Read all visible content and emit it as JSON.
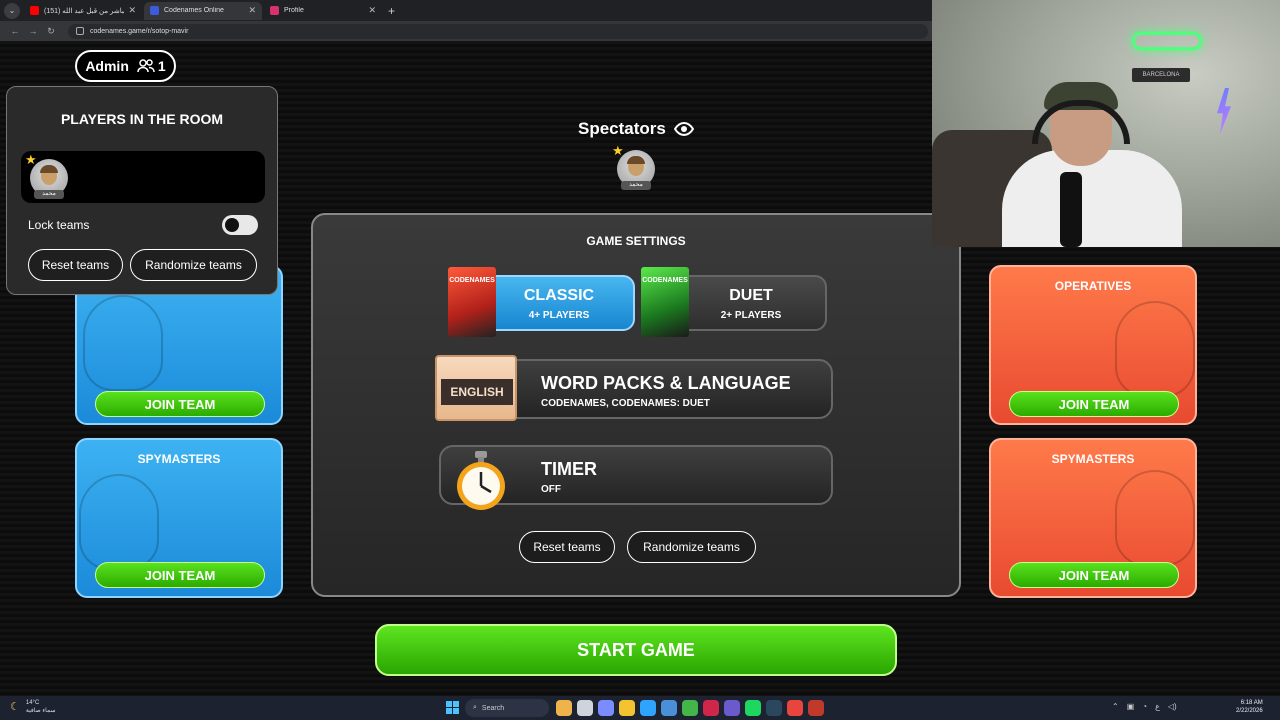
{
  "browser": {
    "tabs": [
      {
        "title": "(151) بث مباشر من قبل عبد الله - ..",
        "favicon_color": "#ff0000",
        "active": false
      },
      {
        "title": "Codenames Online",
        "favicon_color": "#3b5bdb",
        "active": true
      },
      {
        "title": "Profile",
        "favicon_color": "#d6336c",
        "active": false
      }
    ],
    "new_tab": "+",
    "url": "codenames.game/r/sotop-mavir"
  },
  "header": {
    "admin_label": "Admin",
    "player_count": "1"
  },
  "players_popup": {
    "title": "PLAYERS IN THE ROOM",
    "player_name": "محمد",
    "lock_teams_label": "Lock teams",
    "reset_label": "Reset teams",
    "randomize_label": "Randomize teams"
  },
  "spectators": {
    "title": "Spectators",
    "player_name": "محمد"
  },
  "blue_team": {
    "join_label": "JOIN TEAM",
    "spymasters_title": "SPYMASTERS",
    "spymasters_join": "JOIN TEAM"
  },
  "red_team": {
    "operatives_title": "OPERATIVES",
    "operatives_join": "JOIN TEAM",
    "spymasters_title": "SPYMASTERS",
    "spymasters_join": "JOIN TEAM"
  },
  "settings": {
    "title": "GAME SETTINGS",
    "classic": {
      "name": "CLASSIC",
      "players": "4+ PLAYERS",
      "box_label": "CODENAMES"
    },
    "duet": {
      "name": "DUET",
      "players": "2+ PLAYERS",
      "box_label": "CODENAMES"
    },
    "word_packs": {
      "title": "WORD PACKS & LANGUAGE",
      "value": "CODENAMES, CODENAMES: DUET",
      "badge": "ENGLISH"
    },
    "timer": {
      "title": "TIMER",
      "value": "OFF"
    },
    "reset_label": "Reset teams",
    "randomize_label": "Randomize teams"
  },
  "start_label": "START GAME",
  "webcam": {
    "shelf_text": "BARCELONA"
  },
  "taskbar": {
    "temperature": "14°C",
    "weather_text": "سماء صافية",
    "search_label": "Search",
    "time": "6:18 AM",
    "date": "2/22/2026",
    "lang": "ع",
    "accent": "#4cc2ff"
  }
}
